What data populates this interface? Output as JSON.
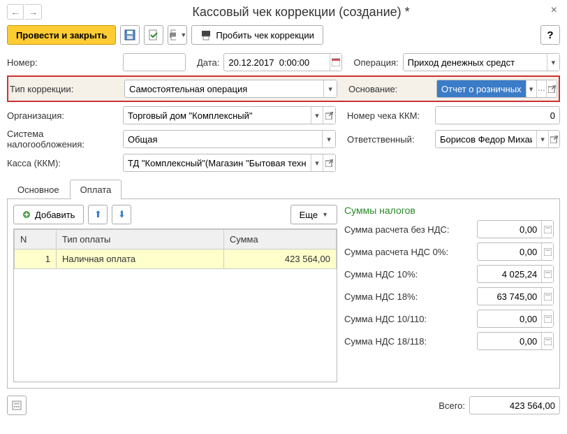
{
  "title": "Кассовый чек коррекции (создание) *",
  "toolbar": {
    "post_and_close": "Провести и закрыть",
    "print_correction": "Пробить чек коррекции",
    "help": "?"
  },
  "fields": {
    "number_label": "Номер:",
    "number_value": "",
    "date_label": "Дата:",
    "date_value": "20.12.2017  0:00:00",
    "operation_label": "Операция:",
    "operation_value": "Приход денежных средст",
    "correction_type_label": "Тип коррекции:",
    "correction_type_value": "Самостоятельная операция",
    "basis_label": "Основание:",
    "basis_value": "Отчет о розничных",
    "org_label": "Организация:",
    "org_value": "Торговый дом \"Комплексный\"",
    "kkm_number_label": "Номер чека ККМ:",
    "kkm_number_value": "0",
    "tax_system_label": "Система налогообложения:",
    "tax_system_value": "Общая",
    "responsible_label": "Ответственный:",
    "responsible_value": "Борисов Федор Михаи",
    "kkm_label": "Касса (ККМ):",
    "kkm_value": "ТД \"Комплексный\"(Магазин \"Бытовая техник"
  },
  "tabs": [
    "Основное",
    "Оплата"
  ],
  "active_tab": 1,
  "table_toolbar": {
    "add": "Добавить",
    "more": "Еще"
  },
  "table": {
    "headers": [
      "N",
      "Тип оплаты",
      "Сумма"
    ],
    "rows": [
      {
        "n": "1",
        "type": "Наличная оплата",
        "sum": "423 564,00"
      }
    ]
  },
  "taxes": {
    "title": "Суммы налогов",
    "rows": [
      {
        "label": "Сумма расчета без НДС:",
        "value": "0,00"
      },
      {
        "label": "Сумма расчета НДС 0%:",
        "value": "0,00"
      },
      {
        "label": "Сумма НДС 10%:",
        "value": "4 025,24"
      },
      {
        "label": "Сумма НДС 18%:",
        "value": "63 745,00"
      },
      {
        "label": "Сумма НДС 10/110:",
        "value": "0,00"
      },
      {
        "label": "Сумма НДС 18/118:",
        "value": "0,00"
      }
    ]
  },
  "footer": {
    "total_label": "Всего:",
    "total_value": "423 564,00"
  }
}
